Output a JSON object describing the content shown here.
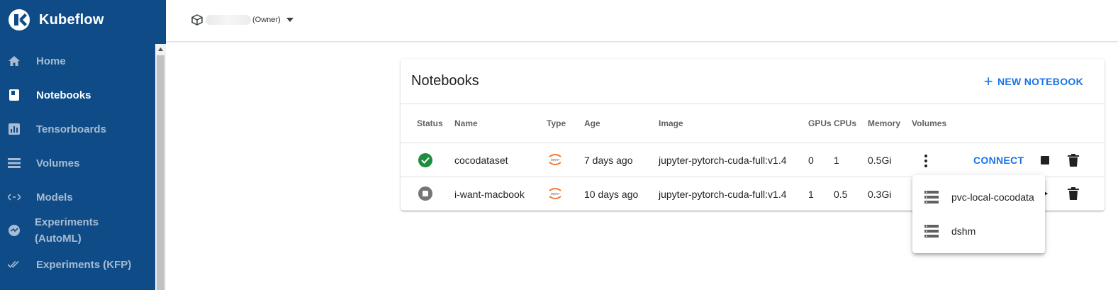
{
  "app": {
    "name": "Kubeflow"
  },
  "sidebar": {
    "items": [
      {
        "label": "Home",
        "icon": "home-icon"
      },
      {
        "label": "Notebooks",
        "icon": "notebook-icon",
        "active": true
      },
      {
        "label": "Tensorboards",
        "icon": "bar-chart-icon"
      },
      {
        "label": "Volumes",
        "icon": "storage-icon"
      },
      {
        "label": "Models",
        "icon": "code-arrows-icon"
      },
      {
        "label": "Experiments",
        "label2": "(AutoML)",
        "icon": "automl-icon"
      },
      {
        "label": "Experiments (KFP)",
        "icon": "done-all-icon"
      }
    ]
  },
  "topbar": {
    "namespace_role": "(Owner)"
  },
  "card": {
    "title": "Notebooks",
    "new_button": "NEW NOTEBOOK",
    "columns": [
      "Status",
      "Name",
      "Type",
      "Age",
      "Image",
      "GPUs",
      "CPUs",
      "Memory",
      "Volumes"
    ],
    "rows": [
      {
        "status": "running",
        "name": "cocodataset",
        "type": "jupyter",
        "age": "7 days ago",
        "image": "jupyter-pytorch-cuda-full:v1.4",
        "gpus": "0",
        "cpus": "1",
        "memory": "0.5Gi",
        "action": "CONNECT"
      },
      {
        "status": "stopped",
        "name": "i-want-macbook",
        "type": "jupyter",
        "age": "10 days ago",
        "image": "jupyter-pytorch-cuda-full:v1.4",
        "gpus": "1",
        "cpus": "0.5",
        "memory": "0.3Gi"
      }
    ],
    "type_icon_text": "jupyter"
  },
  "volumes_popup": {
    "items": [
      {
        "label": "pvc-local-cocodata"
      },
      {
        "label": "dshm"
      }
    ]
  },
  "colors": {
    "sidebar": "#0f4c87",
    "accent": "#1a73e8",
    "ok": "#1e8e3e",
    "stopped": "#757575"
  }
}
